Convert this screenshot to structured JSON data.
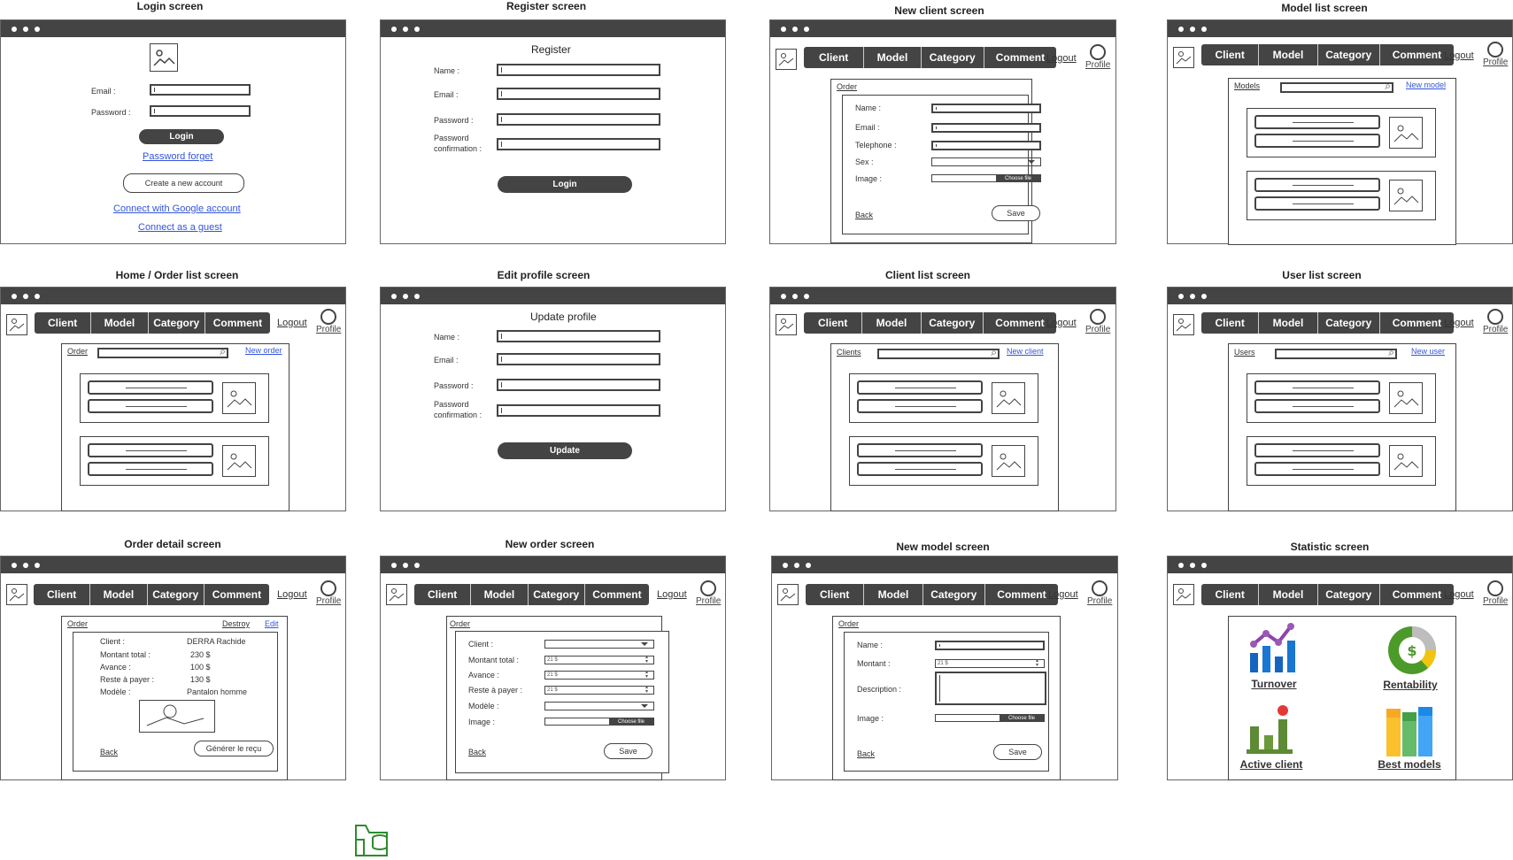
{
  "titles": {
    "login": "Login screen",
    "register": "Register screen",
    "new_client": "New client screen",
    "model_list": "Model list screen",
    "home": "Home / Order list screen",
    "edit_profile": "Edit profile screen",
    "client_list": "Client list screen",
    "user_list": "User list screen",
    "order_detail": "Order detail screen",
    "new_order": "New order screen",
    "new_model": "New model screen",
    "statistic": "Statistic screen"
  },
  "nav": {
    "items": [
      "Client",
      "Model",
      "Category",
      "Comment"
    ],
    "logout": "Logout",
    "profile": "Profile"
  },
  "login": {
    "email_label": "Email :",
    "password_label": "Password :",
    "login_button": "Login",
    "forgot": "Password forget",
    "create": "Create a new account",
    "google": "Connect with Google account",
    "guest": "Connect as a guest"
  },
  "register": {
    "heading": "Register",
    "name": "Name :",
    "email": "Email :",
    "password": "Password :",
    "confirm1": "Password",
    "confirm2": "confirmation :",
    "button": "Login"
  },
  "edit_profile": {
    "heading": "Update profile",
    "name": "Name :",
    "email": "Email :",
    "password": "Password :",
    "confirm1": "Password",
    "confirm2": "confirmation :",
    "button": "Update"
  },
  "new_client": {
    "panel": "Order",
    "name": "Name :",
    "email": "Email :",
    "telephone": "Telephone :",
    "sex": "Sex :",
    "image": "Image :",
    "choose": "Choose file",
    "back": "Back",
    "save": "Save"
  },
  "model_list": {
    "panel": "Models",
    "new": "New model"
  },
  "home": {
    "panel": "Order",
    "new": "New order"
  },
  "client_list": {
    "panel": "Clients",
    "new": "New client"
  },
  "user_list": {
    "panel": "Users",
    "new": "New user"
  },
  "order_detail": {
    "panel": "Order",
    "destroy": "Destroy",
    "edit": "Edit",
    "client_label": "Client :",
    "client_value": "DERRA Rachide",
    "total_label": "Montant total :",
    "total_value": "230 $",
    "avance_label": "Avance :",
    "avance_value": "100 $",
    "reste_label": "Reste à payer :",
    "reste_value": "130 $",
    "modele_label": "Modèle :",
    "modele_value": "Pantalon homme",
    "back": "Back",
    "receipt": "Générer le reçu"
  },
  "new_order": {
    "panel": "Order",
    "client": "Client :",
    "total": "Montant total :",
    "avance": "Avance :",
    "reste": "Reste à payer :",
    "modele": "Modèle :",
    "image": "Image :",
    "num": "21 $",
    "choose": "Choose file",
    "back": "Back",
    "save": "Save"
  },
  "new_model": {
    "panel": "Order",
    "name": "Name :",
    "montant": "Montant :",
    "description": "Description :",
    "image": "Image :",
    "num": "21 $",
    "choose": "Choose file",
    "back": "Back",
    "save": "Save"
  },
  "statistic": {
    "turnover": "Turnover",
    "rentability": "Rentability",
    "active": "Active client",
    "best": "Best models"
  },
  "colors": {
    "bar": "#444444",
    "link": "#3355dd",
    "turnover_blue": "#1565c0",
    "turnover_purple": "#8e44ad",
    "rent_green": "#4c9a2a",
    "rent_yellow": "#f1c40f",
    "active_green": "#5d8a34",
    "active_red": "#e53935",
    "best_yellow": "#fbc02d",
    "best_green": "#66bb6a",
    "best_blue": "#42a5f5"
  }
}
